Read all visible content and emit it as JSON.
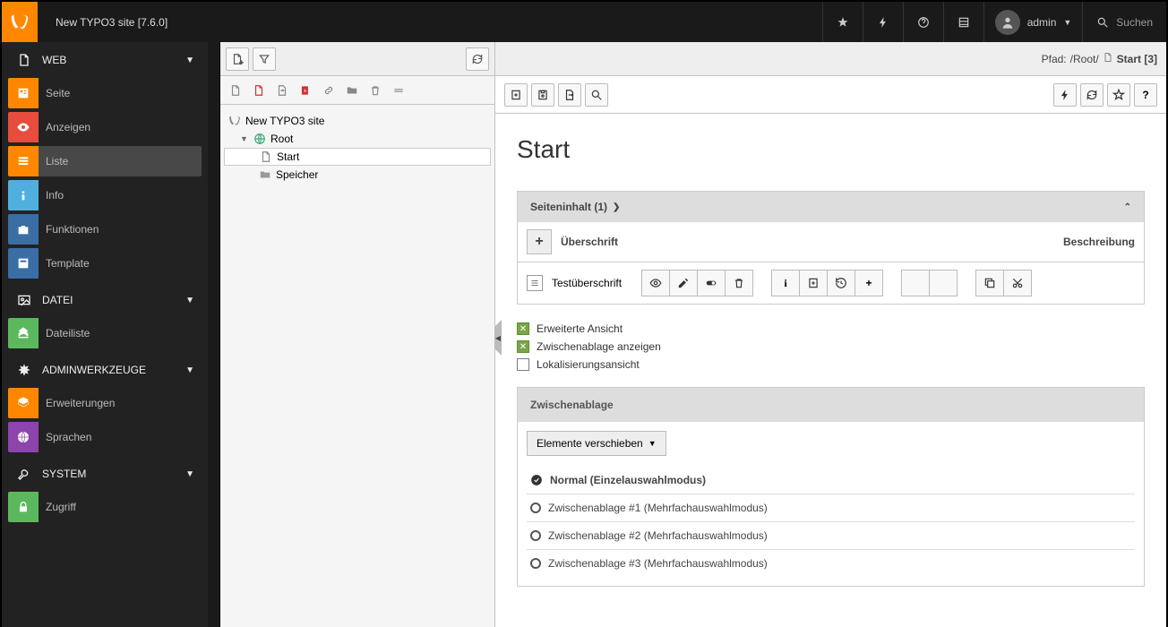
{
  "topbar": {
    "site_title": "New TYPO3 site [7.6.0]",
    "user_label": "admin",
    "search_placeholder": "Suchen"
  },
  "sidebar": {
    "groups": [
      {
        "label": "WEB",
        "items": [
          {
            "label": "Seite",
            "color": "#ff8700"
          },
          {
            "label": "Anzeigen",
            "color": "#e74c3c"
          },
          {
            "label": "Liste",
            "color": "#ff8700",
            "active": true
          },
          {
            "label": "Info",
            "color": "#4fb0e0"
          },
          {
            "label": "Funktionen",
            "color": "#3a6ea5"
          },
          {
            "label": "Template",
            "color": "#3a6ea5"
          }
        ]
      },
      {
        "label": "DATEI",
        "items": [
          {
            "label": "Dateiliste",
            "color": "#5cb85c"
          }
        ]
      },
      {
        "label": "ADMINWERKZEUGE",
        "items": [
          {
            "label": "Erweiterungen",
            "color": "#ff8700"
          },
          {
            "label": "Sprachen",
            "color": "#8e44ad"
          }
        ]
      },
      {
        "label": "SYSTEM",
        "items": [
          {
            "label": "Zugriff",
            "color": "#5cb85c"
          }
        ]
      }
    ]
  },
  "tree": {
    "root_label": "New TYPO3 site",
    "nodes": [
      {
        "label": "Root",
        "depth": 1,
        "expanded": true
      },
      {
        "label": "Start",
        "depth": 2,
        "selected": true
      },
      {
        "label": "Speicher",
        "depth": 2
      }
    ]
  },
  "content": {
    "path_prefix": "Pfad: ",
    "path_root": "/Root/",
    "path_page": "Start [3]",
    "page_title": "Start",
    "panel_title": "Seiteninhalt (1)",
    "col_header": "Überschrift",
    "col_desc": "Beschreibung",
    "row_title": "Testüberschrift",
    "checks": {
      "extended": "Erweiterte Ansicht",
      "clipboard": "Zwischenablage anzeigen",
      "localization": "Lokalisierungsansicht"
    },
    "clipboard": {
      "header": "Zwischenablage",
      "move_btn": "Elemente verschieben",
      "items": [
        "Normal (Einzelauswahlmodus)",
        "Zwischenablage #1 (Mehrfachauswahlmodus)",
        "Zwischenablage #2 (Mehrfachauswahlmodus)",
        "Zwischenablage #3 (Mehrfachauswahlmodus)"
      ]
    }
  }
}
